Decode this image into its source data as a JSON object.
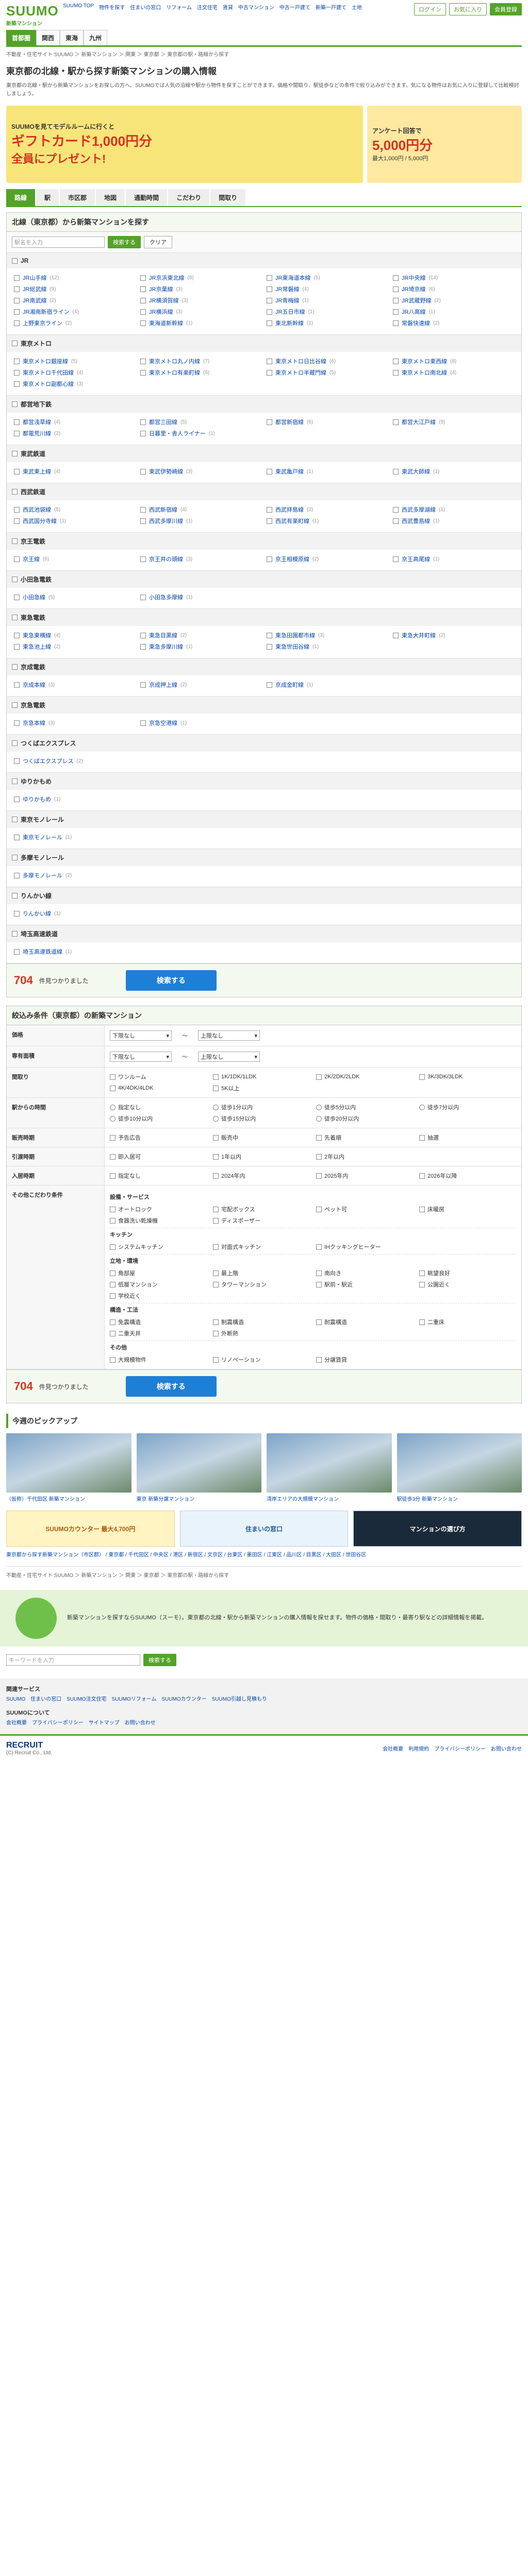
{
  "header": {
    "logo": "SUUMO",
    "logo_sub": "新築マンション",
    "topnav": [
      "SUUMO TOP",
      "物件を探す",
      "住まいの窓口",
      "リフォーム",
      "注文住宅",
      "賃貸",
      "中古マンション",
      "中古一戸建て",
      "新築一戸建て",
      "土地"
    ],
    "btn_login": "ログイン",
    "btn_register": "会員登録",
    "btn_mylist": "お気に入り",
    "gnav": [
      "首都圏",
      "関西",
      "東海",
      "九州"
    ],
    "gnav_active": 0
  },
  "breadcrumb": "不動産・住宅サイト SUUMO ＞ 新築マンション ＞ 関東 ＞ 東京都 ＞ 東京都の駅・路線から探す",
  "title": "東京都の北線・駅から探す新築マンションの購入情報",
  "lead": "東京都の北線・駅から新築マンションをお探しの方へ。SUUMOでは人気の沿線や駅から物件を探すことができます。価格や間取り、駅徒歩などの条件で絞り込みができます。気になる物件はお気に入りに登録して比較検討しましょう。",
  "banners": {
    "left_head": "SUUMOを見てモデルルームに行くと",
    "left_gift": "ギフトカード1,000円分",
    "left_tail": "全員にプレゼント!",
    "right_head": "アンケート回答で",
    "right_big": "5,000円分",
    "right_sub": "最大1,000円 / 5,000円"
  },
  "tabs": [
    "路線",
    "駅",
    "市区郡",
    "地図",
    "通勤時間",
    "こだわり",
    "間取り"
  ],
  "tabs_active": 0,
  "station_search": {
    "heading": "北線（東京都）から新築マンションを探す",
    "placeholder": "駅名を入力",
    "search_btn": "検索する",
    "clear_btn": "クリア"
  },
  "line_groups": [
    {
      "name": "JR",
      "stations": [
        {
          "n": "JR山手線",
          "c": "(12)"
        },
        {
          "n": "JR京浜東北線",
          "c": "(8)"
        },
        {
          "n": "JR東海道本線",
          "c": "(5)"
        },
        {
          "n": "JR中央線",
          "c": "(14)"
        },
        {
          "n": "JR総武線",
          "c": "(9)"
        },
        {
          "n": "JR京葉線",
          "c": "(3)"
        },
        {
          "n": "JR常磐線",
          "c": "(4)"
        },
        {
          "n": "JR埼京線",
          "c": "(6)"
        },
        {
          "n": "JR南武線",
          "c": "(2)"
        },
        {
          "n": "JR横須賀線",
          "c": "(3)"
        },
        {
          "n": "JR青梅線",
          "c": "(1)"
        },
        {
          "n": "JR武蔵野線",
          "c": "(2)"
        },
        {
          "n": "JR湘南新宿ライン",
          "c": "(4)"
        },
        {
          "n": "JR横浜線",
          "c": "(3)"
        },
        {
          "n": "JR五日市線",
          "c": "(1)"
        },
        {
          "n": "JR八高線",
          "c": "(1)"
        },
        {
          "n": "上野東京ライン",
          "c": "(2)"
        },
        {
          "n": "東海道新幹線",
          "c": "(1)"
        },
        {
          "n": "東北新幹線",
          "c": "(1)"
        },
        {
          "n": "常磐快速線",
          "c": "(2)"
        }
      ]
    },
    {
      "name": "東京メトロ",
      "stations": [
        {
          "n": "東京メトロ銀座線",
          "c": "(5)"
        },
        {
          "n": "東京メトロ丸ノ内線",
          "c": "(7)"
        },
        {
          "n": "東京メトロ日比谷線",
          "c": "(6)"
        },
        {
          "n": "東京メトロ東西線",
          "c": "(8)"
        },
        {
          "n": "東京メトロ千代田線",
          "c": "(4)"
        },
        {
          "n": "東京メトロ有楽町線",
          "c": "(6)"
        },
        {
          "n": "東京メトロ半蔵門線",
          "c": "(5)"
        },
        {
          "n": "東京メトロ南北線",
          "c": "(4)"
        },
        {
          "n": "東京メトロ副都心線",
          "c": "(3)"
        }
      ]
    },
    {
      "name": "都営地下鉄",
      "stations": [
        {
          "n": "都営浅草線",
          "c": "(4)"
        },
        {
          "n": "都営三田線",
          "c": "(5)"
        },
        {
          "n": "都営新宿線",
          "c": "(6)"
        },
        {
          "n": "都営大江戸線",
          "c": "(9)"
        },
        {
          "n": "都電荒川線",
          "c": "(2)"
        },
        {
          "n": "日暮里・舎人ライナー",
          "c": "(1)"
        },
        {
          "n": "",
          "c": ""
        },
        {
          "n": "",
          "c": ""
        }
      ]
    },
    {
      "name": "東武鉄道",
      "stations": [
        {
          "n": "東武東上線",
          "c": "(4)"
        },
        {
          "n": "東武伊勢崎線",
          "c": "(3)"
        },
        {
          "n": "東武亀戸線",
          "c": "(1)"
        },
        {
          "n": "東武大師線",
          "c": "(1)"
        }
      ]
    },
    {
      "name": "西武鉄道",
      "stations": [
        {
          "n": "西武池袋線",
          "c": "(5)"
        },
        {
          "n": "西武新宿線",
          "c": "(4)"
        },
        {
          "n": "西武拝島線",
          "c": "(2)"
        },
        {
          "n": "西武多摩湖線",
          "c": "(1)"
        },
        {
          "n": "西武国分寺線",
          "c": "(1)"
        },
        {
          "n": "西武多摩川線",
          "c": "(1)"
        },
        {
          "n": "西武有楽町線",
          "c": "(1)"
        },
        {
          "n": "西武豊島線",
          "c": "(1)"
        }
      ]
    },
    {
      "name": "京王電鉄",
      "stations": [
        {
          "n": "京王線",
          "c": "(6)"
        },
        {
          "n": "京王井の頭線",
          "c": "(3)"
        },
        {
          "n": "京王相模原線",
          "c": "(2)"
        },
        {
          "n": "京王高尾線",
          "c": "(1)"
        }
      ]
    },
    {
      "name": "小田急電鉄",
      "stations": [
        {
          "n": "小田急線",
          "c": "(5)"
        },
        {
          "n": "小田急多摩線",
          "c": "(1)"
        },
        {
          "n": "",
          "c": ""
        },
        {
          "n": "",
          "c": ""
        }
      ]
    },
    {
      "name": "東急電鉄",
      "stations": [
        {
          "n": "東急東横線",
          "c": "(4)"
        },
        {
          "n": "東急目黒線",
          "c": "(2)"
        },
        {
          "n": "東急田園都市線",
          "c": "(3)"
        },
        {
          "n": "東急大井町線",
          "c": "(2)"
        },
        {
          "n": "東急池上線",
          "c": "(2)"
        },
        {
          "n": "東急多摩川線",
          "c": "(1)"
        },
        {
          "n": "東急世田谷線",
          "c": "(1)"
        },
        {
          "n": "",
          "c": ""
        }
      ]
    },
    {
      "name": "京成電鉄",
      "stations": [
        {
          "n": "京成本線",
          "c": "(3)"
        },
        {
          "n": "京成押上線",
          "c": "(2)"
        },
        {
          "n": "京成金町線",
          "c": "(1)"
        },
        {
          "n": "",
          "c": ""
        }
      ]
    },
    {
      "name": "京急電鉄",
      "stations": [
        {
          "n": "京急本線",
          "c": "(3)"
        },
        {
          "n": "京急空港線",
          "c": "(1)"
        },
        {
          "n": "",
          "c": ""
        },
        {
          "n": "",
          "c": ""
        }
      ]
    },
    {
      "name": "つくばエクスプレス",
      "stations": [
        {
          "n": "つくばエクスプレス",
          "c": "(2)"
        },
        {
          "n": "",
          "c": ""
        },
        {
          "n": "",
          "c": ""
        },
        {
          "n": "",
          "c": ""
        }
      ]
    },
    {
      "name": "ゆりかもめ",
      "stations": [
        {
          "n": "ゆりかもめ",
          "c": "(1)"
        },
        {
          "n": "",
          "c": ""
        },
        {
          "n": "",
          "c": ""
        },
        {
          "n": "",
          "c": ""
        }
      ]
    },
    {
      "name": "東京モノレール",
      "stations": [
        {
          "n": "東京モノレール",
          "c": "(1)"
        },
        {
          "n": "",
          "c": ""
        },
        {
          "n": "",
          "c": ""
        },
        {
          "n": "",
          "c": ""
        }
      ]
    },
    {
      "name": "多摩モノレール",
      "stations": [
        {
          "n": "多摩モノレール",
          "c": "(2)"
        },
        {
          "n": "",
          "c": ""
        },
        {
          "n": "",
          "c": ""
        },
        {
          "n": "",
          "c": ""
        }
      ]
    },
    {
      "name": "りんかい線",
      "stations": [
        {
          "n": "りんかい線",
          "c": "(1)"
        },
        {
          "n": "",
          "c": ""
        },
        {
          "n": "",
          "c": ""
        },
        {
          "n": "",
          "c": ""
        }
      ]
    },
    {
      "name": "埼玉高速鉄道",
      "stations": [
        {
          "n": "埼玉高速鉄道線",
          "c": "(1)"
        },
        {
          "n": "",
          "c": ""
        },
        {
          "n": "",
          "c": ""
        },
        {
          "n": "",
          "c": ""
        }
      ]
    }
  ],
  "result_top": {
    "count": "704",
    "unit": "件見つかりました",
    "btn": "検索する"
  },
  "conditions": {
    "heading": "絞込み条件（東京都）の新築マンション",
    "rows": [
      {
        "label": "価格",
        "options": [
          "下限なし",
          "～",
          "上限なし"
        ]
      },
      {
        "label": "専有面積",
        "options": [
          "下限なし",
          "～",
          "上限なし"
        ]
      },
      {
        "label": "間取り",
        "options": [
          "ワンルーム",
          "1K/1DK/1LDK",
          "2K/2DK/2LDK",
          "3K/3DK/3LDK",
          "4K/4DK/4LDK",
          "5K以上"
        ]
      },
      {
        "label": "駅からの時間",
        "options": [
          "指定なし",
          "徒歩1分以内",
          "徒歩5分以内",
          "徒歩7分以内",
          "徒歩10分以内",
          "徒歩15分以内",
          "徒歩20分以内"
        ]
      },
      {
        "label": "販売時期",
        "options": [
          "予告広告",
          "販売中",
          "先着順",
          "抽選"
        ]
      },
      {
        "label": "引渡時期",
        "options": [
          "即入居可",
          "1年以内",
          "2年以内"
        ]
      },
      {
        "label": "入居時期",
        "options": [
          "指定なし",
          "2024年内",
          "2025年内",
          "2026年以降"
        ]
      }
    ],
    "special_label": "その他こだわり条件",
    "special": [
      {
        "h": "設備・サービス",
        "items": [
          "オートロック",
          "宅配ボックス",
          "ペット可",
          "床暖房",
          "食器洗い乾燥機",
          "ディスポーザー"
        ]
      },
      {
        "h": "キッチン",
        "items": [
          "システムキッチン",
          "対面式キッチン",
          "IHクッキングヒーター"
        ]
      },
      {
        "h": "立地・環境",
        "items": [
          "角部屋",
          "最上階",
          "南向き",
          "眺望良好",
          "低層マンション",
          "タワーマンション",
          "駅前・駅近",
          "公園近く",
          "学校近く"
        ]
      },
      {
        "h": "構造・工法",
        "items": [
          "免震構造",
          "制震構造",
          "耐震構造",
          "二重床",
          "二重天井",
          "外断熱"
        ]
      },
      {
        "h": "その他",
        "items": [
          "大規模物件",
          "リノベーション",
          "分譲賃貸"
        ]
      }
    ]
  },
  "result_bottom": {
    "count": "704",
    "unit": "件見つかりました",
    "btn": "検索する"
  },
  "pickup": {
    "heading": "今週のピックアップ",
    "items": [
      "（仮称）千代田区 新築マンション",
      "東京 新築分譲マンション",
      "湾岸エリアの大規模マンション",
      "駅徒歩3分 新築マンション"
    ]
  },
  "ads": [
    "SUUMOカウンター 最大4,700円",
    "住まいの窓口",
    "マンションの選び方"
  ],
  "mini_links": "東京都から探す新築マンション（市区郡） / 東京都 / 千代田区 / 中央区 / 港区 / 新宿区 / 文京区 / 台東区 / 墨田区 / 江東区 / 品川区 / 目黒区 / 大田区 / 世田谷区",
  "footer_breadcrumb": "不動産・住宅サイト SUUMO ＞ 新築マンション ＞ 関東 ＞ 東京都 ＞ 東京都の駅・路線から探す",
  "mascot_text": "新築マンションを探すならSUUMO（スーモ）。東京都の北線・駅から新築マンションの購入情報を探せます。物件の価格・間取り・最寄り駅などの詳細情報を掲載。",
  "footer_search": {
    "placeholder": "キーワードを入力",
    "btn": "検索する"
  },
  "footer": {
    "h1": "関連サービス",
    "links1": [
      "SUUMO",
      "住まいの窓口",
      "SUUMO注文住宅",
      "SUUMOリフォーム",
      "SUUMOカウンター",
      "SUUMO引越し見積もり"
    ],
    "h2": "SUUMOについて",
    "links2": [
      "会社概要",
      "プライバシーポリシー",
      "サイトマップ",
      "お問い合わせ"
    ]
  },
  "bottom": {
    "brand": "RECRUIT",
    "copy": "(C) Recruit Co., Ltd.",
    "links": [
      "会社概要",
      "利用規約",
      "プライバシーポリシー",
      "お問い合わせ"
    ]
  }
}
